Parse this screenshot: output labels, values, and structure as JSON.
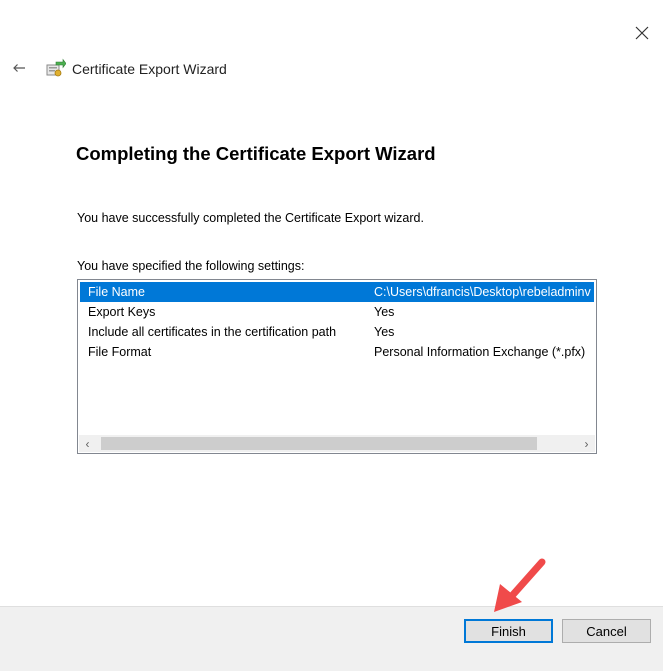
{
  "window": {
    "title": "Certificate Export Wizard",
    "close_glyph": "✕"
  },
  "page": {
    "heading": "Completing the Certificate Export Wizard",
    "success_text": "You have successfully completed the Certificate Export wizard.",
    "settings_label": "You have specified the following settings:"
  },
  "settings": {
    "rows": [
      {
        "key": "File Name",
        "value": "C:\\Users\\dfrancis\\Desktop\\rebeladminv"
      },
      {
        "key": "Export Keys",
        "value": "Yes"
      },
      {
        "key": "Include all certificates in the certification path",
        "value": "Yes"
      },
      {
        "key": "File Format",
        "value": "Personal Information Exchange (*.pfx)"
      }
    ],
    "selected_index": 0,
    "scroll_left_glyph": "‹",
    "scroll_right_glyph": "›"
  },
  "buttons": {
    "finish": "Finish",
    "cancel": "Cancel"
  },
  "colors": {
    "selection": "#0078d7",
    "annotation_arrow": "#f04a4a"
  }
}
